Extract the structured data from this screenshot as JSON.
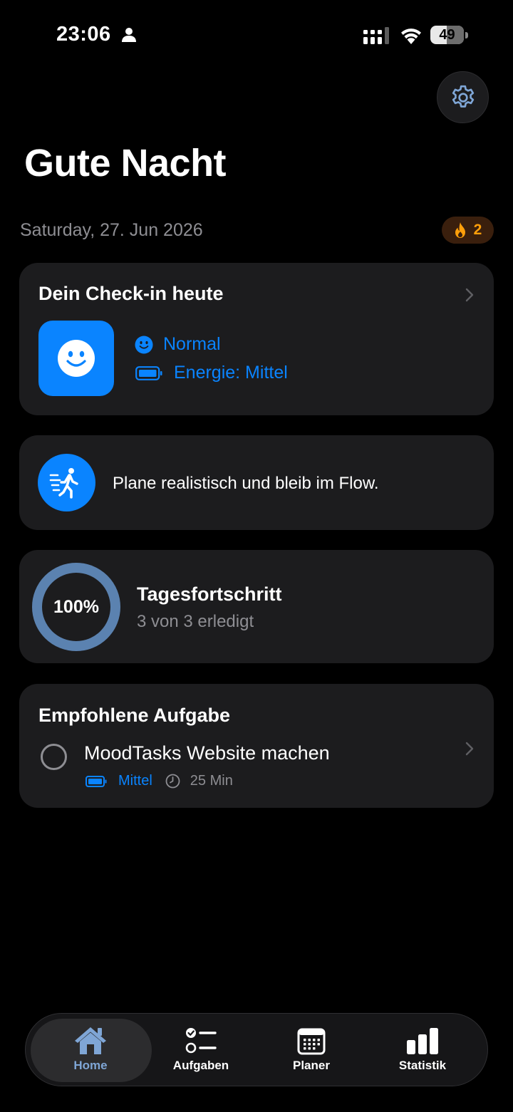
{
  "status_bar": {
    "time": "23:06",
    "battery_level": "49",
    "battery_fraction": 0.49
  },
  "header": {
    "title": "Gute Nacht"
  },
  "date": "Saturday, 27. Jun 2026",
  "streak": {
    "count": "2"
  },
  "checkin": {
    "title": "Dein Check-in heute",
    "mood": "Normal",
    "energy": "Energie: Mittel"
  },
  "tip": {
    "text": "Plane realistisch und bleib im Flow."
  },
  "progress": {
    "percent_label": "100%",
    "fraction": 1.0,
    "title": "Tagesfortschritt",
    "subtitle": "3 von 3 erledigt"
  },
  "recommended": {
    "title": "Empfohlene Aufgabe",
    "task_title": "MoodTasks Website machen",
    "energy": "Mittel",
    "duration": "25 Min"
  },
  "tabs": [
    {
      "label": "Home",
      "active": true
    },
    {
      "label": "Aufgaben",
      "active": false
    },
    {
      "label": "Planer",
      "active": false
    },
    {
      "label": "Statistik",
      "active": false
    }
  ],
  "colors": {
    "accent": "#0a84ff",
    "streak": "#ff9f0a",
    "ring": "#5b82b0",
    "tab_active": "#7fa6d6"
  }
}
